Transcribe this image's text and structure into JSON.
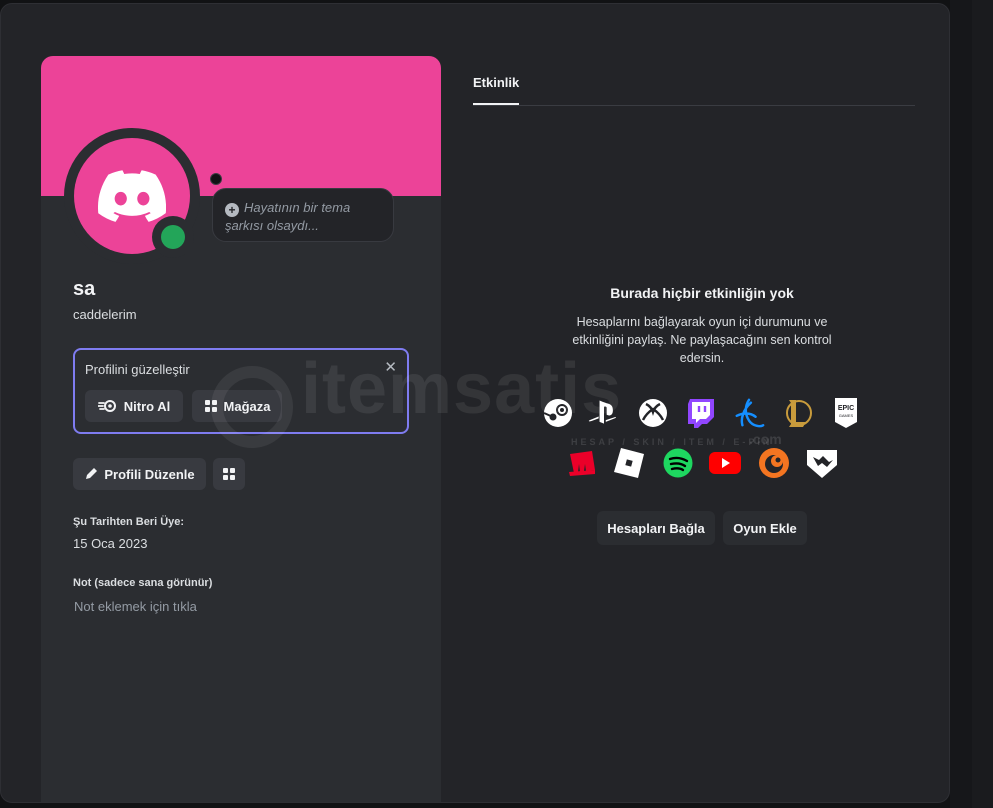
{
  "profile": {
    "display_name": "sa",
    "username": "caddelerim",
    "song_placeholder": "Hayatının bir tema şarkısı olsaydı...",
    "banner_color": "#ec4398",
    "status_color": "#23a559"
  },
  "promo": {
    "title": "Profilini güzelleştir",
    "nitro_label": "Nitro Al",
    "shop_label": "Mağaza"
  },
  "actions": {
    "edit_label": "Profili Düzenle"
  },
  "member_since": {
    "label": "Şu Tarihten Beri Üye:",
    "value": "15 Oca 2023"
  },
  "note": {
    "label": "Not (sadece sana görünür)",
    "placeholder": "Not eklemek için tıkla"
  },
  "tabs": [
    {
      "label": "Etkinlik",
      "active": true
    }
  ],
  "activity": {
    "empty_title": "Burada hiçbir etkinliğin yok",
    "empty_desc": "Hesaplarını bağlayarak oyun içi durumunu ve etkinliğini paylaş. Ne paylaşacağını sen kontrol edersin.",
    "platforms_row1": [
      "steam-icon",
      "playstation-icon",
      "xbox-icon",
      "twitch-icon",
      "battlenet-icon",
      "league-of-legends-icon",
      "epic-games-icon"
    ],
    "platforms_row2": [
      "riot-games-icon",
      "roblox-icon",
      "spotify-icon",
      "youtube-icon",
      "crunchyroll-icon",
      "bungie-icon"
    ],
    "connect_label": "Hesapları Bağla",
    "add_game_label": "Oyun Ekle"
  },
  "watermark": {
    "text": "itemsatis",
    "sub": "HESAP / SKIN / ITEM / E-PIN",
    "domain": ".com"
  }
}
